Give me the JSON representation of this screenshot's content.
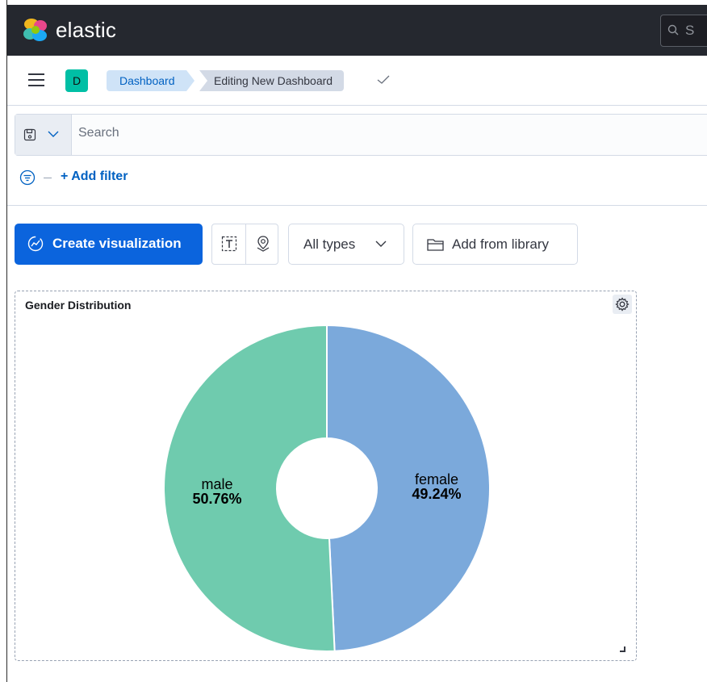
{
  "header": {
    "brand": "elastic",
    "search_text": "S"
  },
  "nav": {
    "space_initial": "D",
    "breadcrumbs": [
      "Dashboard",
      "Editing New Dashboard"
    ]
  },
  "query": {
    "placeholder": "Search"
  },
  "filters": {
    "add_filter": "+ Add filter"
  },
  "toolbar": {
    "create_label": "Create visualization",
    "types_label": "All types",
    "library_label": "Add from library"
  },
  "panel": {
    "title": "Gender Distribution"
  },
  "chart_data": {
    "type": "pie",
    "donut": true,
    "categories": [
      "female",
      "male"
    ],
    "values": [
      49.24,
      50.76
    ],
    "labels": [
      "49.24%",
      "50.76%"
    ],
    "colors": [
      "#7ba9db",
      "#6fcbae"
    ]
  }
}
